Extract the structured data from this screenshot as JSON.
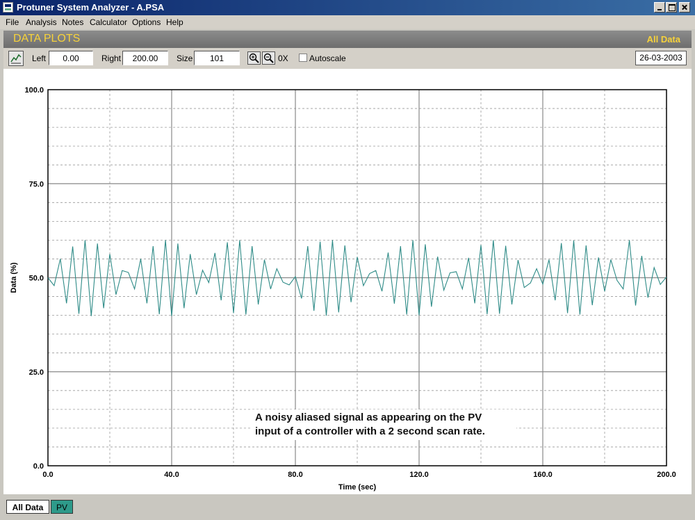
{
  "window": {
    "title": "Protuner System Analyzer - A.PSA"
  },
  "menu": [
    "File",
    "Analysis",
    "Notes",
    "Calculator",
    "Options",
    "Help"
  ],
  "panel": {
    "title": "DATA PLOTS",
    "view_label": "All Data"
  },
  "toolbar": {
    "left_label": "Left",
    "left_value": "0.00",
    "right_label": "Right",
    "right_value": "200.00",
    "size_label": "Size",
    "size_value": "101",
    "zero_x_label": "0X",
    "autoscale_label": "Autoscale",
    "autoscale_checked": false,
    "date": "26-03-2003"
  },
  "annotation": {
    "line1": "A noisy aliased signal as appearing on the PV",
    "line2": "input of a controller with a 2 second scan rate."
  },
  "tabs": [
    {
      "label": "All Data",
      "active": true
    },
    {
      "label": "PV",
      "active": false
    }
  ],
  "colors": {
    "series": "#2e8b87",
    "panel_title": "#f7d23a",
    "tab_pv": "#2e9a8a"
  },
  "icons": {
    "plot": "line-chart-icon",
    "zoom_in": "zoom-in-icon",
    "zoom_out": "zoom-out-icon"
  },
  "chart_data": {
    "type": "line",
    "xlabel": "Time (sec)",
    "ylabel": "Data (%)",
    "xlim": [
      0,
      200
    ],
    "ylim": [
      0,
      100
    ],
    "x_ticks": [
      "0.0",
      "40.0",
      "80.0",
      "120.0",
      "160.0",
      "200.0"
    ],
    "y_ticks": [
      "0.0",
      "25.0",
      "50.0",
      "75.0",
      "100.0"
    ],
    "grid": true,
    "series": [
      {
        "color": "#2e8b87",
        "x_start": 0,
        "x_step": 2,
        "values": [
          50.0,
          47.9,
          55.0,
          43.2,
          58.3,
          40.4,
          60.0,
          39.8,
          59.1,
          41.9,
          56.3,
          45.5,
          51.9,
          51.4,
          47.0,
          55.0,
          43.2,
          58.4,
          40.3,
          60.0,
          39.8,
          59.1,
          41.9,
          56.3,
          45.5,
          52.0,
          48.7,
          56.6,
          44.0,
          59.4,
          40.6,
          60.0,
          40.2,
          58.4,
          42.9,
          54.8,
          47.0,
          52.4,
          48.8,
          48.1,
          50.3,
          44.5,
          58.4,
          41.2,
          59.6,
          39.9,
          60.0,
          40.8,
          58.6,
          43.5,
          55.5,
          47.9,
          51.1,
          51.9,
          46.4,
          56.7,
          43.1,
          58.4,
          40.2,
          60.0,
          40.0,
          58.9,
          42.3,
          55.6,
          46.7,
          51.3,
          51.6,
          47.0,
          55.3,
          43.2,
          58.7,
          40.3,
          60.0,
          40.4,
          58.5,
          42.9,
          54.7,
          47.4,
          48.6,
          52.4,
          48.3,
          54.8,
          44.0,
          59.2,
          40.6,
          59.9,
          40.2,
          58.6,
          42.7,
          55.4,
          46.4,
          54.8,
          49.3,
          47.0,
          60.0,
          42.6,
          55.8,
          44.7,
          52.7,
          48.2,
          50.2
        ]
      }
    ]
  }
}
